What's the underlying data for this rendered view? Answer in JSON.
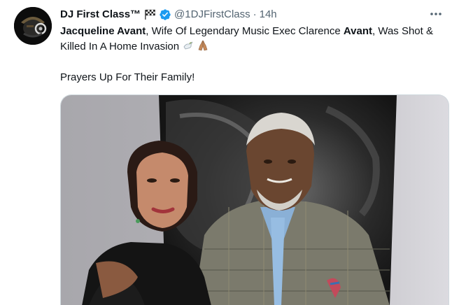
{
  "tweet": {
    "author": {
      "display_name": "DJ First Class™",
      "handle": "@1DJFirstClass",
      "name_emoji": "checkered-flag-icon",
      "verified": "verified-badge-icon"
    },
    "separator": "·",
    "time": "14h",
    "more_icon": "more-options-icon",
    "text": {
      "bold_1": "Jacqueline Avant",
      "part_1": ", Wife Of Legendary Music Exec Clarence ",
      "bold_2": "Avant",
      "part_2": ", Was Shot & Killed In A Home Invasion ",
      "emoji_1": "dove-icon",
      "emoji_2": "folded-hands-icon",
      "line_2": "Prayers Up For Their Family!"
    },
    "media": {
      "type": "photo",
      "subject": "couple-photo"
    },
    "colors": {
      "text": "#0f1419",
      "secondary": "#536471",
      "verified": "#1d9bf0",
      "border": "#cfd9de"
    }
  }
}
